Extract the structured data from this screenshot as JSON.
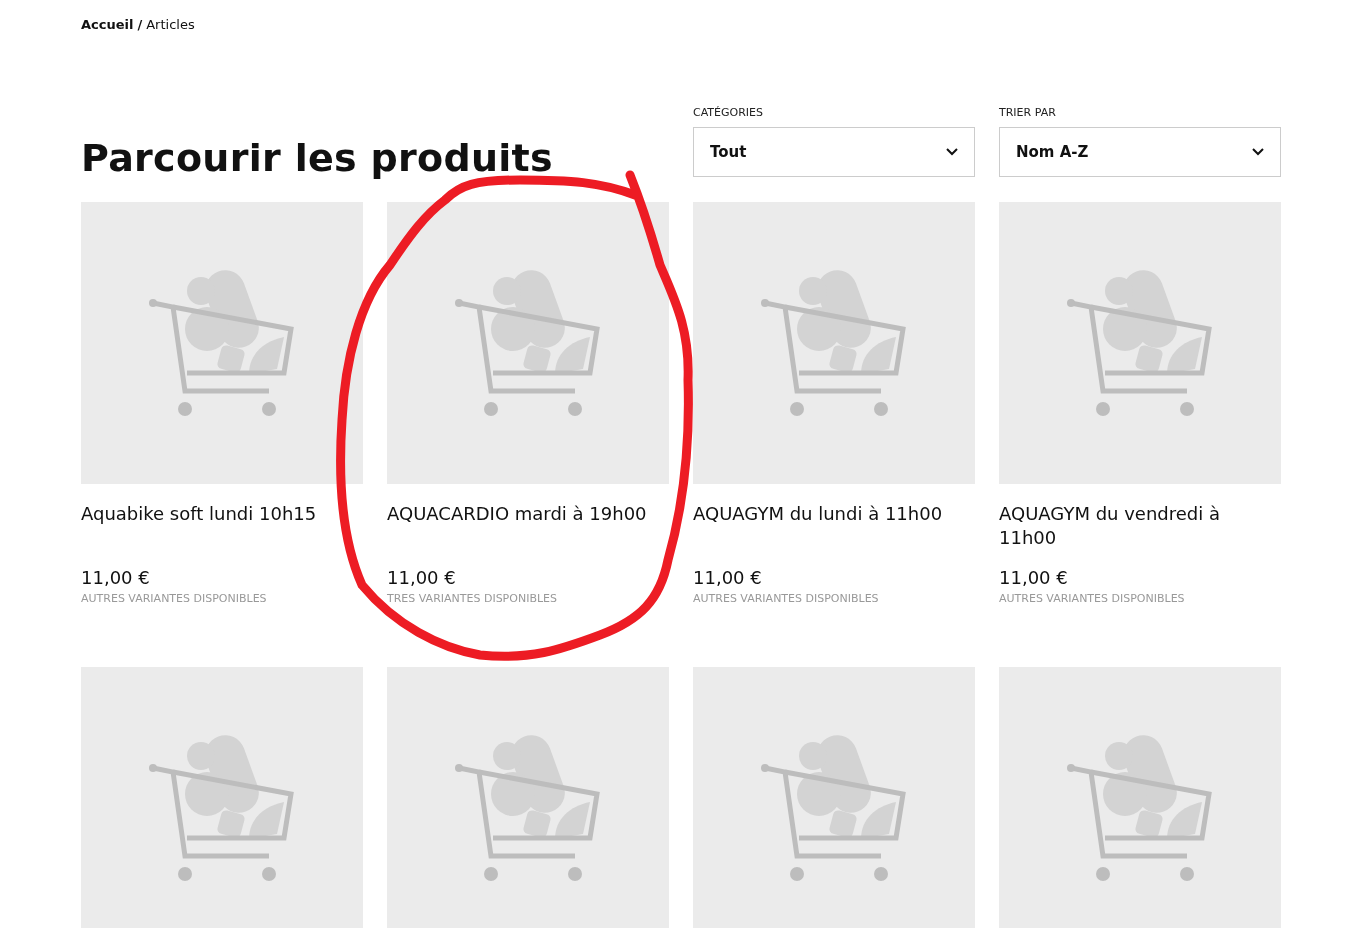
{
  "breadcrumb": {
    "home": "Accueil",
    "separator": "/",
    "current": "Articles"
  },
  "heading": "Parcourir les produits",
  "filters": [
    {
      "label": "CATÉGORIES",
      "value": "Tout"
    },
    {
      "label": "TRIER PAR",
      "value": "Nom A-Z"
    }
  ],
  "products": [
    {
      "kind": "full",
      "name": "Aquabike soft lundi 10h15",
      "price": "11,00 €",
      "note": "AUTRES VARIANTES DISPONIBLES"
    },
    {
      "kind": "full",
      "name": "AQUACARDIO mardi à 19h00",
      "price": "11,00 €",
      "note": "TRES VARIANTES DISPONIBLES"
    },
    {
      "kind": "full",
      "name": "AQUAGYM du lundi à 11h00",
      "price": "11,00 €",
      "note": "AUTRES VARIANTES DISPONIBLES"
    },
    {
      "kind": "full",
      "name": "AQUAGYM du vendredi à 11h00",
      "price": "11,00 €",
      "note": "AUTRES VARIANTES DISPONIBLES"
    },
    {
      "kind": "image_only"
    },
    {
      "kind": "image_only"
    },
    {
      "kind": "image_only"
    },
    {
      "kind": "image_only"
    }
  ],
  "annotation": {
    "kind": "circle",
    "color": "#ed1c24"
  }
}
